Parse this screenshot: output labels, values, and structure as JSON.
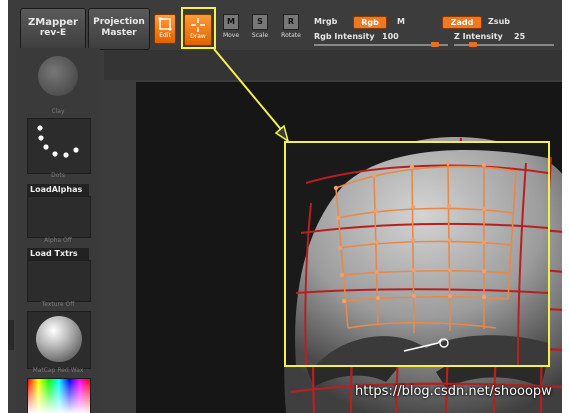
{
  "toolbar": {
    "zmapper": {
      "line1": "ZMapper",
      "line2": "rev-E"
    },
    "projection": {
      "line1": "Projection",
      "line2": "Master"
    },
    "tools": [
      {
        "label": "Edit",
        "icon": "edit-icon",
        "active": true
      },
      {
        "label": "Draw",
        "icon": "draw-icon",
        "active": true
      },
      {
        "label": "Move",
        "icon": "move-icon",
        "glyph": "M"
      },
      {
        "label": "Scale",
        "icon": "scale-icon",
        "glyph": "S"
      },
      {
        "label": "Rotate",
        "icon": "rotate-icon",
        "glyph": "R"
      }
    ],
    "mrgb": "Mrgb",
    "rgb": "Rgb",
    "m": "M",
    "rgb_intensity_label": "Rgb  Intensity",
    "rgb_intensity_value": "100",
    "zadd": "Zadd",
    "zsub": "Zsub",
    "z_intensity_label": "Z  Intensity",
    "z_intensity_value": "25",
    "accent": "#f07820"
  },
  "sidebar": {
    "brush_caption": "Clay",
    "stroke_caption": "Dots",
    "alpha_title": "LoadAlphas",
    "alpha_caption": "Alpha Off",
    "texture_title": "Load Txtrs",
    "texture_caption": "Texture Off",
    "material_caption": "MatCap Red Wax"
  },
  "annotation": {
    "color": "#f2f24a"
  },
  "watermark": "https://blog.csdn.net/shooopw"
}
